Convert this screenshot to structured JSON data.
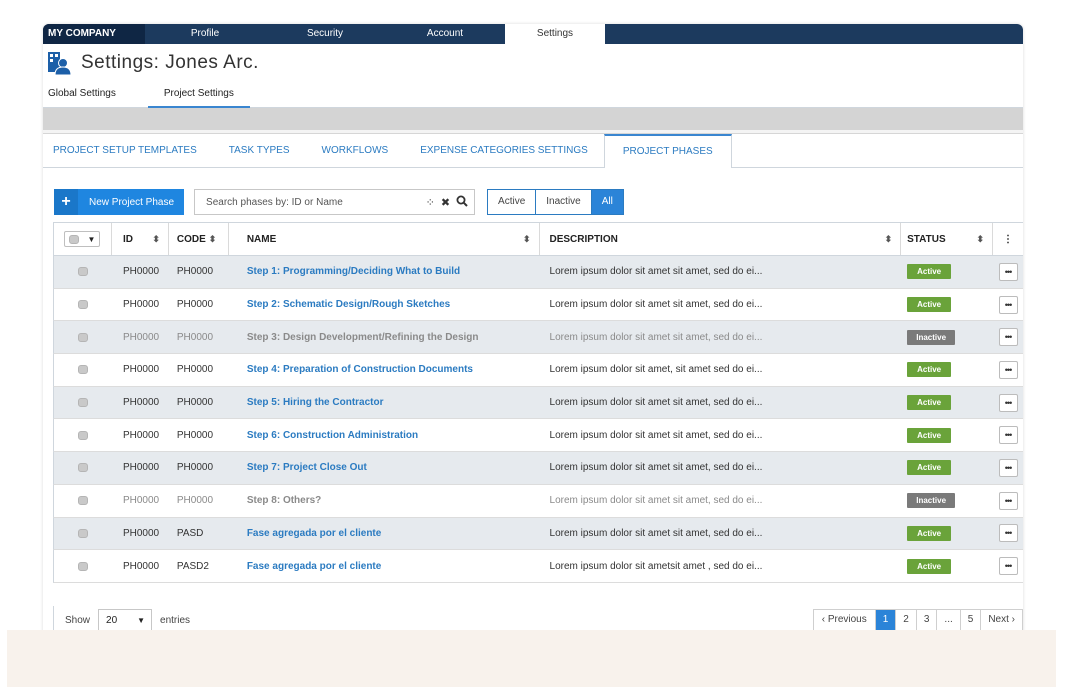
{
  "topnav": {
    "brand": "MY COMPANY",
    "items": [
      "Profile",
      "Security",
      "Account",
      "Settings"
    ]
  },
  "header": {
    "title": "Settings:  Jones Arc."
  },
  "subtabs": [
    "Global Settings",
    "Project Settings"
  ],
  "project_tabs": [
    "PROJECT SETUP TEMPLATES",
    "TASK TYPES",
    "WORKFLOWS",
    "EXPENSE CATEGORIES SETTINGS",
    "PROJECT PHASES"
  ],
  "toolbar": {
    "new_label": "New Project Phase",
    "search_placeholder": "Search phases by: ID or Name",
    "filters": [
      "Active",
      "Inactive",
      "All"
    ],
    "selected_filter": "All"
  },
  "columns": {
    "id": "ID",
    "code": "CODE",
    "name": "NAME",
    "description": "DESCRIPTION",
    "status": "STATUS"
  },
  "rows": [
    {
      "id": "PH0000",
      "code": "PH0000",
      "name": "Step 1: Programming/Deciding What to Build",
      "description": "Lorem ipsum dolor sit amet sit amet,  sed do ei...",
      "status": "Active"
    },
    {
      "id": "PH0000",
      "code": "PH0000",
      "name": "Step 2: Schematic Design/Rough Sketches",
      "description": "Lorem ipsum dolor sit amet sit amet, sed do ei...",
      "status": "Active"
    },
    {
      "id": "PH0000",
      "code": "PH0000",
      "name": "Step 3: Design Development/Refining the Design",
      "description": "Lorem ipsum dolor sit amet sit amet, sed do ei...",
      "status": "Inactive"
    },
    {
      "id": "PH0000",
      "code": "PH0000",
      "name": "Step 4: Preparation of Construction Documents",
      "description": "Lorem ipsum dolor sit amet, sit amet sed do ei...",
      "status": "Active"
    },
    {
      "id": "PH0000",
      "code": "PH0000",
      "name": "Step 5: Hiring the Contractor",
      "description": "Lorem ipsum dolor sit amet sit amet, sed do ei...",
      "status": "Active"
    },
    {
      "id": "PH0000",
      "code": "PH0000",
      "name": "Step 6: Construction Administration",
      "description": "Lorem ipsum dolor sit amet sit amet, sed do ei...",
      "status": "Active"
    },
    {
      "id": "PH0000",
      "code": "PH0000",
      "name": "Step 7: Project Close Out",
      "description": "Lorem ipsum dolor sit amet sit amet, sed do ei...",
      "status": "Active"
    },
    {
      "id": "PH0000",
      "code": "PH0000",
      "name": "Step 8: Others?",
      "description": "Lorem ipsum dolor sit amet sit amet, sed do ei...",
      "status": "Inactive"
    },
    {
      "id": "PH0000",
      "code": "PASD",
      "name": "Fase agregada por el cliente",
      "description": "Lorem ipsum dolor sit amet sit amet, sed do ei...",
      "status": "Active"
    },
    {
      "id": "PH0000",
      "code": "PASD2",
      "name": "Fase agregada por el cliente",
      "description": "Lorem ipsum dolor sit ametsit amet , sed do ei...",
      "status": "Active"
    }
  ],
  "footer": {
    "show_label": "Show",
    "page_size": "20",
    "entries_label": "entries",
    "pager": [
      "‹ Previous",
      "1",
      "2",
      "3",
      "...",
      "5",
      "Next ›"
    ],
    "current_page": "1"
  },
  "colors": {
    "nav": "#1c3a5e",
    "accent": "#2b84d8",
    "active": "#6aa33a",
    "inactive": "#7a7a7a"
  }
}
